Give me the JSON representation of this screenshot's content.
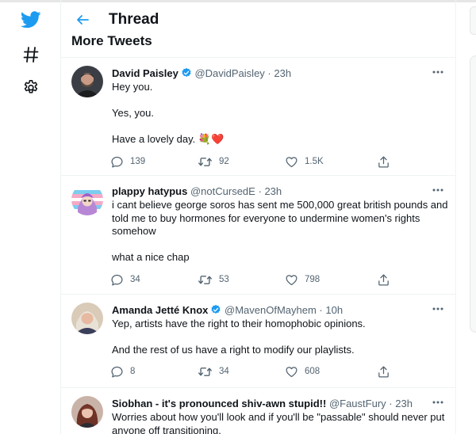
{
  "header": {
    "title": "Thread"
  },
  "section": {
    "title": "More Tweets"
  },
  "colors": {
    "accent": "#1d9bf0",
    "verified": "#1d9bf0",
    "like_heart": "#e0245e"
  },
  "icons": {
    "rail": [
      "twitter-bird-icon",
      "hashtag-icon",
      "gear-icon"
    ],
    "header": "back-arrow-icon",
    "actions": [
      "reply-icon",
      "retweet-icon",
      "like-icon",
      "share-icon"
    ]
  },
  "tweets": [
    {
      "name": "David Paisley",
      "verified": true,
      "handle": "@DavidPaisley",
      "time": "23h",
      "lines": [
        "Hey you.",
        "Yes, you.",
        "Have a lovely day. 💐❤️"
      ],
      "replies": "139",
      "retweets": "92",
      "likes": "1.5K"
    },
    {
      "name": "plappy hatypus",
      "verified": false,
      "handle": "@notCursedE",
      "time": "23h",
      "lines": [
        "i cant believe george soros has sent me 500,000 great british pounds and told me to buy hormones for everyone to undermine women's rights somehow",
        "what a nice chap"
      ],
      "replies": "34",
      "retweets": "53",
      "likes": "798"
    },
    {
      "name": "Amanda Jetté Knox",
      "verified": true,
      "handle": "@MavenOfMayhem",
      "time": "10h",
      "lines": [
        "Yep, artists have the right to their homophobic opinions.",
        "And the rest of us have a right to modify our playlists."
      ],
      "replies": "8",
      "retweets": "34",
      "likes": "608"
    },
    {
      "name": "Siobhan - it's pronounced shiv-awn stupid!!",
      "verified": false,
      "handle": "@FaustFury",
      "time": "23h",
      "lines": [
        "Worries about how you'll look and if you'll be \"passable\" should never put anyone off transitioning."
      ]
    }
  ]
}
